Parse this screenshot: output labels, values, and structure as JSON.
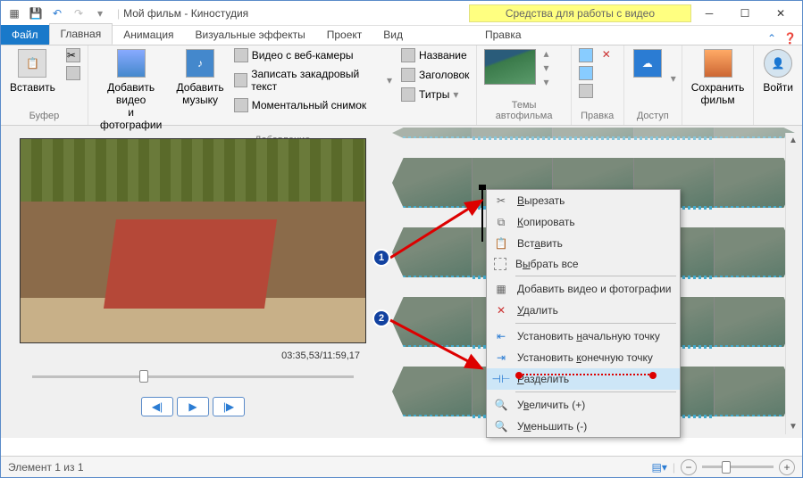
{
  "window": {
    "title": "Мой фильм - Киностудия",
    "videotools": "Средства для работы с видео"
  },
  "tabs": {
    "file": "Файл",
    "home": "Главная",
    "animation": "Анимация",
    "visual": "Визуальные эффекты",
    "project": "Проект",
    "view": "Вид",
    "edit": "Правка"
  },
  "ribbon": {
    "paste": "Вставить",
    "buffer": "Буфер",
    "addvideo": "Добавить видео\nи фотографии",
    "addmusic": "Добавить\nмузыку",
    "webcam": "Видео с веб-камеры",
    "narration": "Записать закадровый текст",
    "snapshot": "Моментальный снимок",
    "adding": "Добавление",
    "titlebtn": "Название",
    "caption": "Заголовок",
    "credits": "Титры",
    "themes": "Темы автофильма",
    "editg": "Правка",
    "access": "Доступ",
    "save": "Сохранить\nфильм",
    "login": "Войти"
  },
  "preview": {
    "time": "03:35,53/11:59,17"
  },
  "context": {
    "cut": "Вырезать",
    "copy": "Копировать",
    "paste": "Вставить",
    "selectall": "Выбрать все",
    "addmedia": "Добавить видео и фотографии",
    "delete": "Удалить",
    "setstart": "Установить начальную точку",
    "setend": "Установить конечную точку",
    "split": "Разделить",
    "zoomin": "Увеличить (+)",
    "zoomout": "Уменьшить (-)"
  },
  "badges": {
    "one": "1",
    "two": "2"
  },
  "status": {
    "text": "Элемент 1 из 1"
  }
}
